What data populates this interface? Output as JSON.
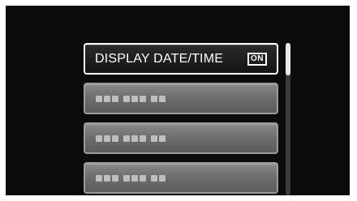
{
  "menu": {
    "items": [
      {
        "label": "DISPLAY DATE/TIME",
        "value": "ON",
        "selected": true
      },
      {
        "placeholder": true
      },
      {
        "placeholder": true
      },
      {
        "placeholder": true
      }
    ]
  },
  "scrollbar": {
    "position": 0
  }
}
